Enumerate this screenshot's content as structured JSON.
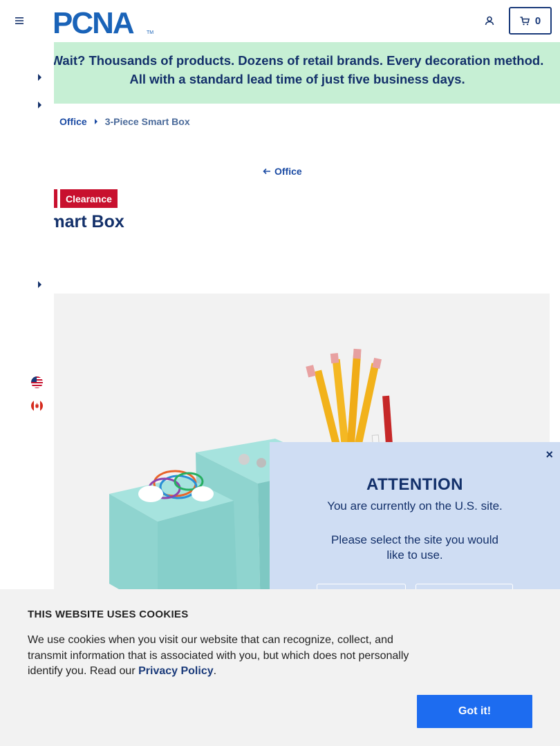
{
  "header": {
    "logo_text": "PCNA",
    "logo_trademark": "TM",
    "cart_count": "0"
  },
  "promo": {
    "text": "Wait? Thousands of products. Dozens of retail brands. Every decoration method. All with a standard lead time of just five business days."
  },
  "breadcrumb": {
    "parent": "Office",
    "current": "3-Piece Smart Box"
  },
  "back_link": {
    "label": "Office"
  },
  "badges": {
    "clearance": "Clearance"
  },
  "product": {
    "title": "ce Smart Box"
  },
  "modal": {
    "close": "×",
    "title": "ATTENTION",
    "line1": "You are currently on the U.S. site.",
    "line2": "Please select the site you would like to use."
  },
  "cookie": {
    "title": "THIS WEBSITE USES COOKIES",
    "body_before": "We use cookies when you visit our website that can recognize, collect, and transmit information that is associated with you, but which does not personally identify you. Read our ",
    "link": "Privacy Policy",
    "body_after": ".",
    "button": "Got it!"
  },
  "colors": {
    "brand_navy": "#13306a",
    "link_blue": "#1a4aa3",
    "promo_bg": "#c6efd4",
    "badge_red": "#c8102e",
    "modal_bg": "#cfddf3",
    "cookie_button": "#1d6cf0"
  },
  "icons": {
    "menu": "hamburger-menu-icon",
    "account": "user-icon",
    "cart": "cart-icon",
    "caret": "caret-right-icon",
    "back": "arrow-left-icon",
    "flag_us": "us-flag-icon",
    "flag_ca": "canada-flag-icon"
  }
}
